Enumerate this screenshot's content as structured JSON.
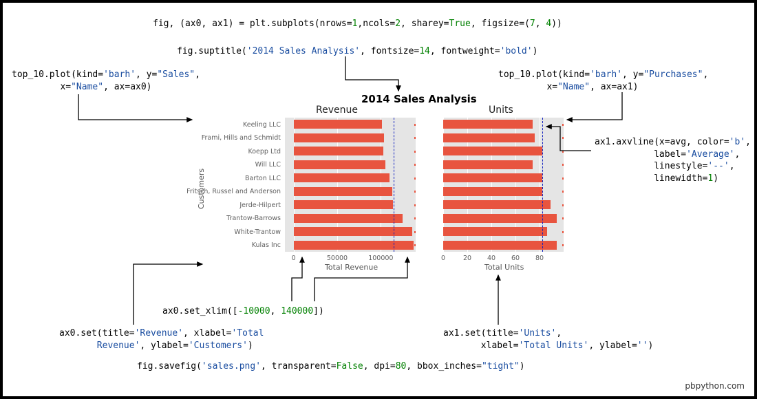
{
  "code": {
    "subplots": {
      "pre": "fig, (ax0, ax1) = plt.subplots(nrows=",
      "nrows": "1",
      "mid1": ",ncols=",
      "ncols": "2",
      "mid2": ", sharey=",
      "sharey": "True",
      "mid3": ", figsize=(",
      "fw": "7",
      "mid4": ", ",
      "fh": "4",
      "end": "))"
    },
    "suptitle": {
      "pre": "fig.suptitle(",
      "title": "'2014 Sales Analysis'",
      "mid1": ", fontsize=",
      "fs": "14",
      "mid2": ", fontweight=",
      "fw": "'bold'",
      "end": ")"
    },
    "plot_left": {
      "pre": "top_10.plot(kind=",
      "kind": "'barh'",
      "mid1": ", y=",
      "y": "\"Sales\"",
      "mid2": ",\n         x=",
      "x": "\"Name\"",
      "mid3": ", ax=ax0)"
    },
    "plot_right": {
      "pre": "top_10.plot(kind=",
      "kind": "'barh'",
      "mid1": ", y=",
      "y": "\"Purchases\"",
      "mid2": ",\n         x=",
      "x": "\"Name\"",
      "mid3": ", ax=ax1)"
    },
    "axvline": {
      "pre": "ax1.axvline(x=avg, color=",
      "color": "'b'",
      "mid1": ",\n           label=",
      "label": "'Average'",
      "mid2": ",\n           linestyle=",
      "ls": "'--'",
      "mid3": ",\n           linewidth=",
      "lw": "1",
      "end": ")"
    },
    "xlim": {
      "pre": "ax0.set_xlim([",
      "lo": "-10000",
      "mid": ", ",
      "hi": "140000",
      "end": "])"
    },
    "set_left": {
      "pre": "ax0.set(title=",
      "title": "'Revenue'",
      "mid1": ", xlabel=",
      "xl": "'Total\n       Revenue'",
      "mid2": ", ylabel=",
      "yl": "'Customers'",
      "end": ")"
    },
    "set_right": {
      "pre": "ax1.set(title=",
      "title": "'Units'",
      "mid1": ",\n       xlabel=",
      "xl": "'Total Units'",
      "mid2": ", ylabel=",
      "yl": "''",
      "end": ")"
    },
    "savefig": {
      "pre": "fig.savefig(",
      "fn": "'sales.png'",
      "mid1": ", transparent=",
      "tr": "False",
      "mid2": ", dpi=",
      "dpi": "80",
      "mid3": ", bbox_inches=",
      "bb": "\"tight\"",
      "end": ")"
    }
  },
  "credit": "pbpython.com",
  "chart_data": {
    "type": "bar",
    "suptitle": "2014 Sales Analysis",
    "ylabel": "Customers",
    "categories": [
      "Keeling LLC",
      "Frami, Hills and Schmidt",
      "Koepp Ltd",
      "Will LLC",
      "Barton LLC",
      "Fritsch, Russel and Anderson",
      "Jerde-Hilpert",
      "Trantow-Barrows",
      "White-Trantow",
      "Kulas Inc"
    ],
    "panels": [
      {
        "title": "Revenue",
        "xlabel": "Total Revenue",
        "xlim": [
          -10000,
          140000
        ],
        "xticks": [
          0,
          50000,
          100000
        ],
        "values": [
          101000,
          104000,
          103000,
          105000,
          110000,
          113000,
          114000,
          125000,
          136000,
          138000
        ],
        "avg_line": 115000
      },
      {
        "title": "Units",
        "xlabel": "Total Units",
        "xlim": [
          0,
          100
        ],
        "xticks": [
          0,
          20,
          40,
          60,
          80
        ],
        "values": [
          74,
          76,
          82,
          74,
          82,
          82,
          89,
          94,
          86,
          94
        ],
        "avg_line": 82
      }
    ]
  }
}
